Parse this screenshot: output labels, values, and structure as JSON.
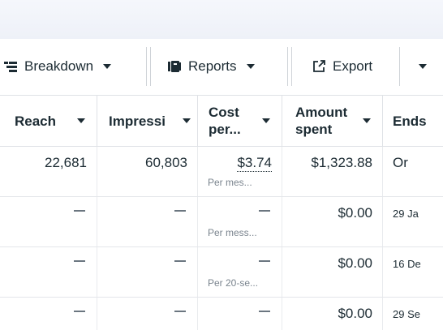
{
  "toolbar": {
    "breakdown_label": "Breakdown",
    "reports_label": "Reports",
    "export_label": "Export"
  },
  "columns": {
    "reach": "Reach",
    "impressions": "Impressi",
    "cost_per": "Cost per...",
    "amount_spent": "Amount spent",
    "ends": "Ends"
  },
  "rows": [
    {
      "reach": "22,681",
      "impressions": "60,803",
      "cost": "$3.74",
      "cost_sub": "Per mes...",
      "amount": "$1,323.88",
      "ends": "Or"
    },
    {
      "reach": "",
      "impressions": "",
      "cost": "",
      "cost_sub": "Per mess...",
      "amount": "$0.00",
      "ends": "29 Ja"
    },
    {
      "reach": "",
      "impressions": "",
      "cost": "",
      "cost_sub": "Per 20-se...",
      "amount": "$0.00",
      "ends": "16 De"
    },
    {
      "reach": "",
      "impressions": "",
      "cost": "",
      "cost_sub": "",
      "amount": "$0.00",
      "ends": "29 Se"
    }
  ],
  "colors": {
    "text": "#1c2b33",
    "muted": "#7a848e",
    "border": "#dfe2e6"
  }
}
